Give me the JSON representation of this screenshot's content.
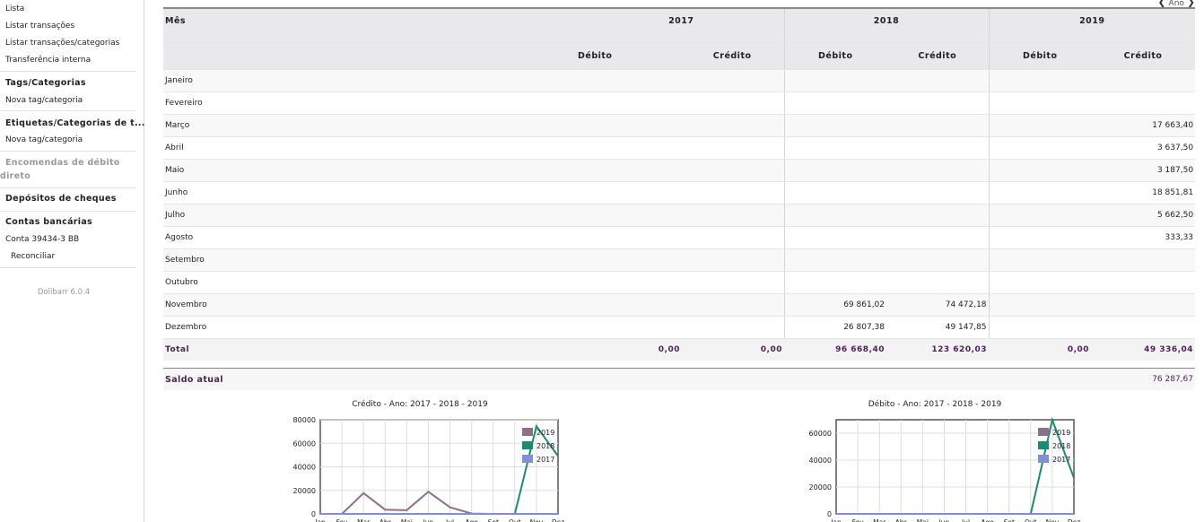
{
  "sidebar": {
    "links_top": [
      "Lista",
      "Listar transações",
      "Listar transações/categorias",
      "Transferência interna"
    ],
    "tags_title": "Tags/Categorias",
    "tags_new": "Nova tag/categoria",
    "etiquetas_title": "Etiquetas/Categorias de t...",
    "etiquetas_new": "Nova tag/categoria",
    "encomendas": "Encomendas de débito direto",
    "depositos": "Depósitos de cheques",
    "contas_title": "Contas bancárias",
    "conta": "Conta 39434-3 BB",
    "reconciliar": "Reconciliar",
    "version": "Dolibarr 6.0.4"
  },
  "nav": {
    "label": "Ano"
  },
  "table": {
    "month_header": "Mês",
    "years": [
      "2017",
      "2018",
      "2019"
    ],
    "debit_label": "Débito",
    "credit_label": "Crédito",
    "rows": [
      {
        "month": "Janeiro",
        "v": [
          "",
          "",
          "",
          "",
          "",
          ""
        ]
      },
      {
        "month": "Fevereiro",
        "v": [
          "",
          "",
          "",
          "",
          "",
          ""
        ]
      },
      {
        "month": "Março",
        "v": [
          "",
          "",
          "",
          "",
          "",
          "17 663,40"
        ]
      },
      {
        "month": "Abril",
        "v": [
          "",
          "",
          "",
          "",
          "",
          "3 637,50"
        ]
      },
      {
        "month": "Maio",
        "v": [
          "",
          "",
          "",
          "",
          "",
          "3 187,50"
        ]
      },
      {
        "month": "Junho",
        "v": [
          "",
          "",
          "",
          "",
          "",
          "18 851,81"
        ]
      },
      {
        "month": "Julho",
        "v": [
          "",
          "",
          "",
          "",
          "",
          "5 662,50"
        ]
      },
      {
        "month": "Agosto",
        "v": [
          "",
          "",
          "",
          "",
          "",
          "333,33"
        ]
      },
      {
        "month": "Setembro",
        "v": [
          "",
          "",
          "",
          "",
          "",
          ""
        ]
      },
      {
        "month": "Outubro",
        "v": [
          "",
          "",
          "",
          "",
          "",
          ""
        ]
      },
      {
        "month": "Novembro",
        "v": [
          "",
          "",
          "69 861,02",
          "74 472,18",
          "",
          ""
        ]
      },
      {
        "month": "Dezembro",
        "v": [
          "",
          "",
          "26 807,38",
          "49 147,85",
          "",
          ""
        ]
      }
    ],
    "total_label": "Total",
    "totals": [
      "0,00",
      "0,00",
      "96 668,40",
      "123 620,03",
      "0,00",
      "49 336,04"
    ]
  },
  "saldo": {
    "label": "Saldo atual",
    "value": "76 287,67"
  },
  "chart_data": [
    {
      "type": "line",
      "title": "Crédito - Ano: 2017 - 2018 - 2019",
      "categories": [
        "Jan",
        "Fev",
        "Mar",
        "Abr",
        "Mai",
        "Jun",
        "Jul",
        "Ago",
        "Set",
        "Out",
        "Nov",
        "Dez"
      ],
      "ylim": [
        0,
        80000
      ],
      "yticks": [
        0,
        20000,
        40000,
        60000,
        80000
      ],
      "grid": true,
      "legend": "top-right",
      "series": [
        {
          "name": "2019",
          "color": "#8b6f8b",
          "values": [
            0,
            0,
            17663.4,
            3637.5,
            3187.5,
            18851.81,
            5662.5,
            333.33,
            0,
            0,
            0,
            0
          ]
        },
        {
          "name": "2018",
          "color": "#1f8a70",
          "values": [
            0,
            0,
            0,
            0,
            0,
            0,
            0,
            0,
            0,
            0,
            74472.18,
            49147.85
          ]
        },
        {
          "name": "2017",
          "color": "#7f8fdc",
          "values": [
            0,
            0,
            0,
            0,
            0,
            0,
            0,
            0,
            0,
            0,
            0,
            0
          ]
        }
      ]
    },
    {
      "type": "line",
      "title": "Débito - Ano: 2017 - 2018 - 2019",
      "categories": [
        "Jan",
        "Fev",
        "Mar",
        "Abr",
        "Mai",
        "Jun",
        "Jul",
        "Ago",
        "Set",
        "Out",
        "Nov",
        "Dez"
      ],
      "ylim": [
        0,
        70000
      ],
      "yticks": [
        0,
        20000,
        40000,
        60000
      ],
      "grid": true,
      "legend": "top-right",
      "series": [
        {
          "name": "2019",
          "color": "#8b6f8b",
          "values": [
            0,
            0,
            0,
            0,
            0,
            0,
            0,
            0,
            0,
            0,
            0,
            0
          ]
        },
        {
          "name": "2018",
          "color": "#1f8a70",
          "values": [
            0,
            0,
            0,
            0,
            0,
            0,
            0,
            0,
            0,
            0,
            69861.02,
            26807.38
          ]
        },
        {
          "name": "2017",
          "color": "#7f8fdc",
          "values": [
            0,
            0,
            0,
            0,
            0,
            0,
            0,
            0,
            0,
            0,
            0,
            0
          ]
        }
      ]
    }
  ]
}
